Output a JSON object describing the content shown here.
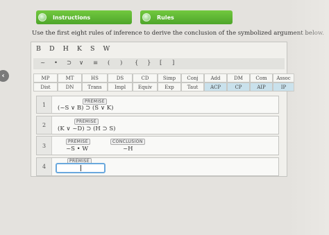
{
  "tabs": [
    {
      "label": "Instructions"
    },
    {
      "label": "Rules"
    }
  ],
  "instruction_text": "Use the first eight rules of inference to derive the conclusion of the symbolized argument below.",
  "back_button_icon": "chevron-left-icon",
  "letters": [
    "B",
    "D",
    "H",
    "K",
    "S",
    "W"
  ],
  "symbols": [
    "~",
    "•",
    "⊃",
    "∨",
    "≡",
    "(",
    ")",
    "{",
    "}",
    "[",
    "]"
  ],
  "rules_row1": [
    "MP",
    "MT",
    "HS",
    "DS",
    "CD",
    "Simp",
    "Conj",
    "Add",
    "DM",
    "Com",
    "Assoc"
  ],
  "rules_row2": [
    "Dist",
    "DN",
    "Trans",
    "Impl",
    "Equiv",
    "Exp",
    "Taut",
    "ACP",
    "CP",
    "AIP",
    "IP"
  ],
  "proof": {
    "line1": {
      "num": "1",
      "tag": "PREMISE",
      "formula": "(~S ∨ B) ⊃ (S ∨ K)"
    },
    "line2": {
      "num": "2",
      "tag": "PREMISE",
      "formula": "(K ∨ ~D) ⊃ (H ⊃ S)"
    },
    "line3": {
      "num": "3",
      "tag": "PREMISE",
      "formula": "~S • W",
      "conclusion_tag": "CONCLUSION",
      "conclusion": "~H"
    },
    "line4": {
      "num": "4",
      "tag": "PREMISE",
      "formula": ""
    }
  },
  "colors": {
    "tab_green": "#5bb531",
    "selected_rule": "#c9e1ec",
    "input_focus": "#69a8dd"
  }
}
